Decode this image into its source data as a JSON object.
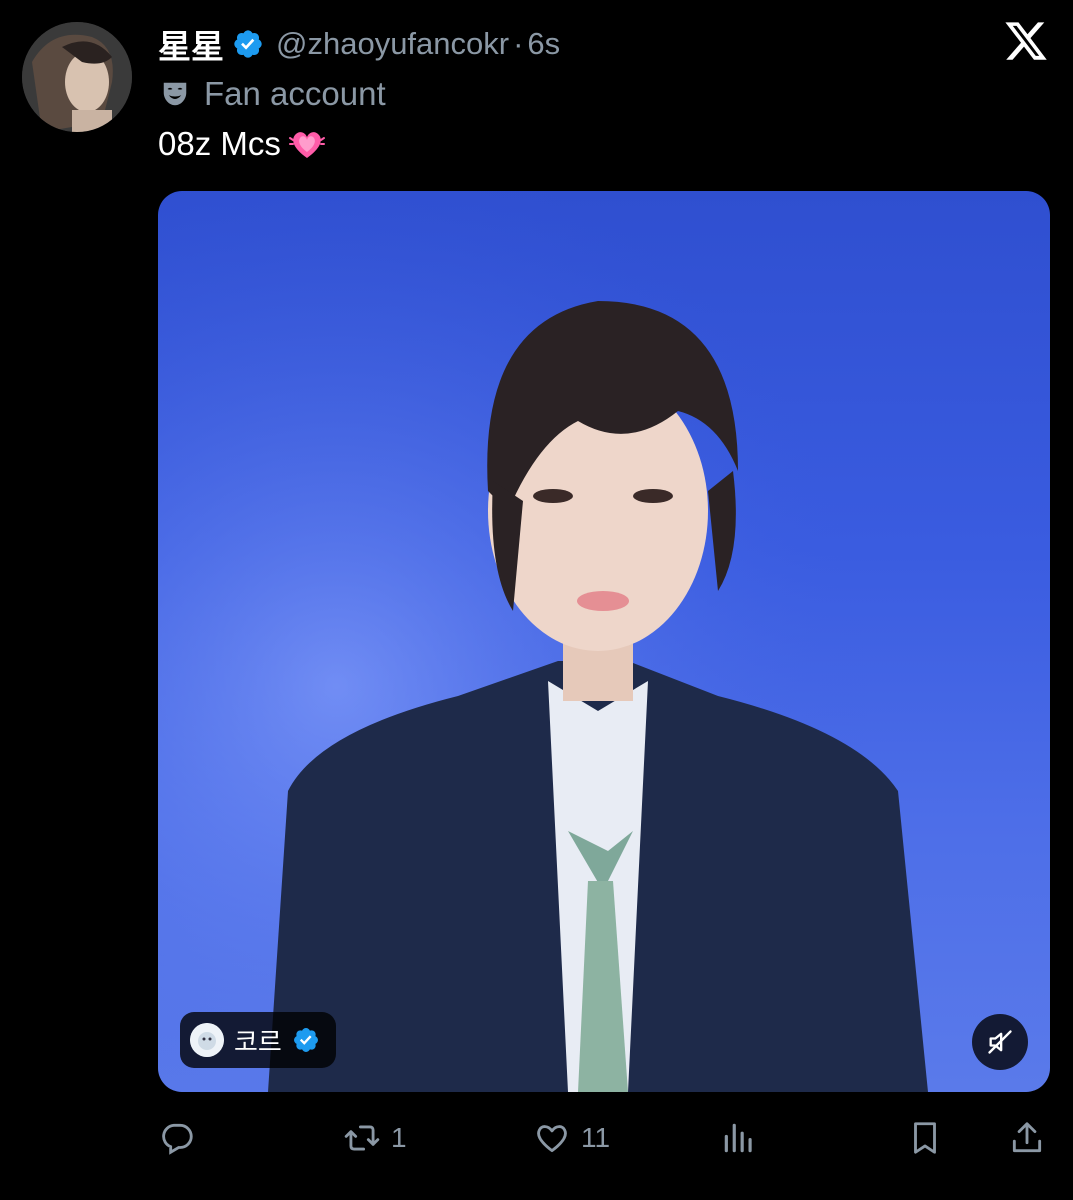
{
  "user": {
    "display_name": "星星",
    "handle": "@zhaoyufancokr",
    "separator": "·",
    "time": "6s",
    "label": "Fan account"
  },
  "tweet": {
    "text": "08z Mcs"
  },
  "media": {
    "source_name": "코르"
  },
  "actions": {
    "reply_count": "",
    "retweet_count": "1",
    "like_count": "11"
  },
  "colors": {
    "verified": "#1d9bf0",
    "muted_text": "#8b98a5",
    "background": "#000000"
  },
  "icons": [
    "x-logo-icon",
    "verified-badge-icon",
    "theater-mask-icon",
    "growing-heart-emoji",
    "mute-icon",
    "reply-icon",
    "retweet-icon",
    "like-icon",
    "views-icon",
    "bookmark-icon",
    "share-icon"
  ]
}
